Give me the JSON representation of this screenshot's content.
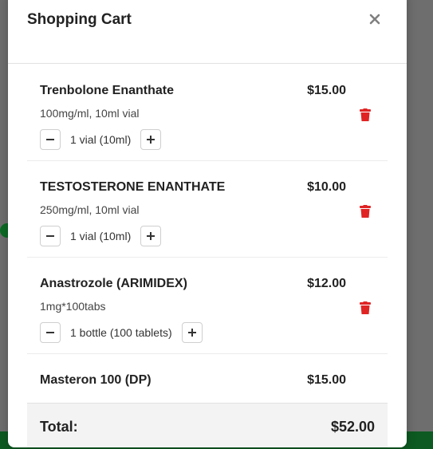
{
  "cart": {
    "title": "Shopping Cart",
    "close_icon": "close-icon",
    "items": [
      {
        "name": "Trenbolone Enanthate",
        "price": "$15.00",
        "variant": "100mg/ml, 10ml vial",
        "quantity": "1 vial (10ml)"
      },
      {
        "name": "TESTOSTERONE ENANTHATE",
        "price": "$10.00",
        "variant": "250mg/ml, 10ml vial",
        "quantity": "1 vial (10ml)"
      },
      {
        "name": "Anastrozole (ARIMIDEX)",
        "price": "$12.00",
        "variant": "1mg*100tabs",
        "quantity": "1 bottle (100 tablets)"
      },
      {
        "name": "Masteron 100 (DP)",
        "price": "$15.00",
        "variant": "",
        "quantity": ""
      }
    ],
    "total_label": "Total:",
    "total_value": "$52.00"
  },
  "colors": {
    "trash": "#e02424",
    "total_bar": "#f3f3f3",
    "overlay": "#6e6e6e",
    "accent_green": "#0d5a22"
  }
}
